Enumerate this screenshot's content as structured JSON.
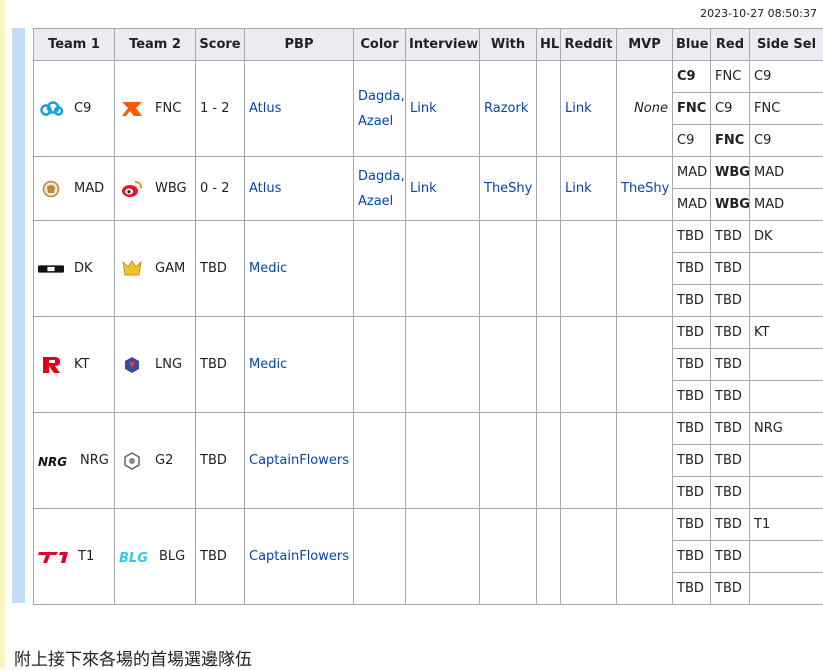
{
  "page": {
    "timestamp": "2023-10-27 08:50:37",
    "top_fragment": "...",
    "footer_text": "附上接下來各場的首場選邊隊伍"
  },
  "colors": {
    "header_bg": "#eaecf0",
    "border": "#a2a9b1",
    "link": "#0645ad",
    "win_green": "#c9f7c6",
    "side_blue": "#9fd3fb",
    "mvp_gray": "#dcdcdc",
    "bar_blue": "#c4dcf4"
  },
  "table": {
    "headers": [
      "Team 1",
      "Team 2",
      "Score",
      "PBP",
      "Color",
      "Interview",
      "With",
      "HL",
      "Reddit",
      "MVP",
      "Blue",
      "Red",
      "Side Sel"
    ],
    "matches": [
      {
        "team1": "C9",
        "team1_icon": "cloud9-logo-icon",
        "team2": "FNC",
        "team2_icon": "fnatic-logo-icon",
        "score": "1 - 2",
        "pbp": "Atlus",
        "color1": "Dagda,",
        "color2": "Azael",
        "interview": "Link",
        "with": "Razork",
        "hl": "",
        "reddit": "Link",
        "mvp": "None",
        "games": [
          {
            "blue": "C9",
            "red": "FNC",
            "side": "C9",
            "winner": "blue"
          },
          {
            "blue": "FNC",
            "red": "C9",
            "side": "FNC",
            "winner": "blue"
          },
          {
            "blue": "C9",
            "red": "FNC",
            "side": "C9",
            "winner": "red"
          }
        ]
      },
      {
        "team1": "MAD",
        "team1_icon": "mad-lions-logo-icon",
        "team2": "WBG",
        "team2_icon": "weibo-logo-icon",
        "score": "0 - 2",
        "pbp": "Atlus",
        "color1": "Dagda,",
        "color2": "Azael",
        "interview": "Link",
        "with": "TheShy",
        "hl": "",
        "reddit": "Link",
        "mvp": "TheShy",
        "games": [
          {
            "blue": "MAD",
            "red": "WBG",
            "side": "MAD",
            "winner": "red"
          },
          {
            "blue": "MAD",
            "red": "WBG",
            "side": "MAD",
            "winner": "red"
          }
        ]
      },
      {
        "team1": "DK",
        "team1_icon": "dk-logo-icon",
        "team2": "GAM",
        "team2_icon": "gam-logo-icon",
        "score": "TBD",
        "pbp": "Medic",
        "games": [
          {
            "blue": "TBD",
            "red": "TBD",
            "side": "DK"
          },
          {
            "blue": "TBD",
            "red": "TBD",
            "side": ""
          },
          {
            "blue": "TBD",
            "red": "TBD",
            "side": ""
          }
        ]
      },
      {
        "team1": "KT",
        "team1_icon": "kt-logo-icon",
        "team2": "LNG",
        "team2_icon": "lng-logo-icon",
        "score": "TBD",
        "pbp": "Medic",
        "games": [
          {
            "blue": "TBD",
            "red": "TBD",
            "side": "KT"
          },
          {
            "blue": "TBD",
            "red": "TBD",
            "side": ""
          },
          {
            "blue": "TBD",
            "red": "TBD",
            "side": ""
          }
        ]
      },
      {
        "team1": "NRG",
        "team1_icon": "nrg-logo-icon",
        "team2": "G2",
        "team2_icon": "g2-logo-icon",
        "score": "TBD",
        "pbp": "CaptainFlowers",
        "games": [
          {
            "blue": "TBD",
            "red": "TBD",
            "side": "NRG"
          },
          {
            "blue": "TBD",
            "red": "TBD",
            "side": ""
          },
          {
            "blue": "TBD",
            "red": "TBD",
            "side": ""
          }
        ]
      },
      {
        "team1": "T1",
        "team1_icon": "t1-logo-icon",
        "team2": "BLG",
        "team2_icon": "blg-logo-icon",
        "score": "TBD",
        "pbp": "CaptainFlowers",
        "games": [
          {
            "blue": "TBD",
            "red": "TBD",
            "side": "T1"
          },
          {
            "blue": "TBD",
            "red": "TBD",
            "side": ""
          },
          {
            "blue": "TBD",
            "red": "TBD",
            "side": ""
          }
        ]
      }
    ]
  }
}
